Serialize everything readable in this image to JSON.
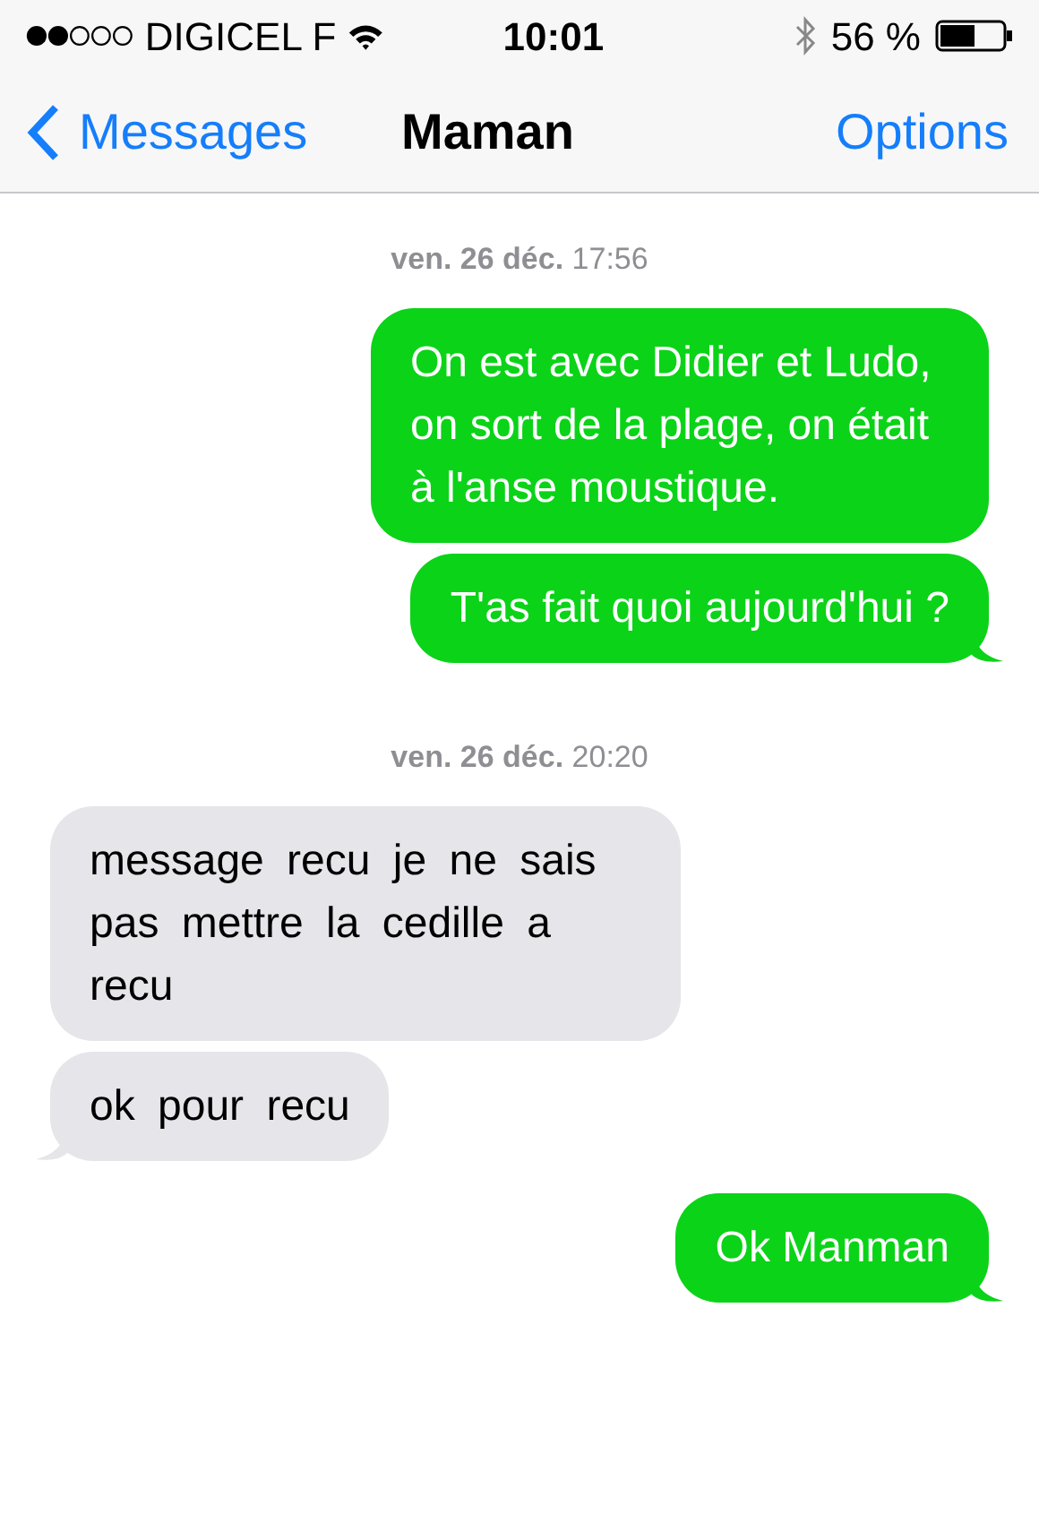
{
  "status_bar": {
    "carrier": "DIGICEL F",
    "time": "10:01",
    "battery": "56 %"
  },
  "nav": {
    "back": "Messages",
    "title": "Maman",
    "action": "Options"
  },
  "thread": [
    {
      "kind": "timestamp",
      "text": "**ven. 26 déc.** 17:56"
    },
    {
      "kind": "sent",
      "text": "On est avec Didier et Ludo, on sort de la plage, on était à l'anse moustique."
    },
    {
      "kind": "sent",
      "text": "T'as fait quoi aujourd'hui ?"
    },
    {
      "kind": "timestamp",
      "text": "**ven. 26 déc.** 20:20"
    },
    {
      "kind": "received",
      "text": "message recu je ne sais pas mettre la cedille a recu"
    },
    {
      "kind": "received",
      "text": "ok pour recu"
    },
    {
      "kind": "sent",
      "text": "Ok Manman"
    }
  ]
}
